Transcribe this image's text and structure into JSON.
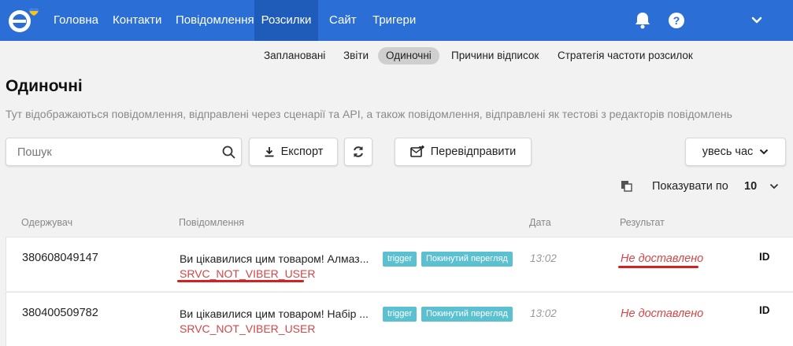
{
  "nav": {
    "items": [
      {
        "label": "Головна"
      },
      {
        "label": "Контакти"
      },
      {
        "label": "Повідомлення"
      },
      {
        "label": "Розсилки"
      },
      {
        "label": "Сайт"
      },
      {
        "label": "Тригери"
      }
    ],
    "active_index": 3
  },
  "subnav": {
    "items": [
      {
        "label": "Заплановані"
      },
      {
        "label": "Звіти"
      },
      {
        "label": "Одиночні"
      },
      {
        "label": "Причини відписок"
      },
      {
        "label": "Стратегія частоти розсилок"
      }
    ]
  },
  "page": {
    "title": "Одиночні",
    "description": "Тут відображаються повідомлення, відправлені через сценарії та API, а також повідомлення, відправлені як тестові з редакторів повідомлень"
  },
  "toolbar": {
    "search_placeholder": "Пошук",
    "export_label": "Експорт",
    "resend_label": "Перевідправити",
    "period_label": "увесь час"
  },
  "pagination": {
    "per_page_label": "Показувати по",
    "per_page_value": "10"
  },
  "table": {
    "columns": {
      "recipient": "Одержувач",
      "message": "Повідомлення",
      "date": "Дата",
      "result": "Результат"
    },
    "rows": [
      {
        "recipient": "380608049147",
        "message": "Ви цікавилися цим товаром! Алмаз...",
        "error": "SRVC_NOT_VIBER_USER",
        "tag1": "trigger",
        "tag2": "Покинутий перегляд",
        "date": "13:02",
        "result": "Не доставлено",
        "id": "ID"
      },
      {
        "recipient": "380400509782",
        "message": "Ви цікавилися цим товаром! Набір ...",
        "error": "SRVC_NOT_VIBER_USER",
        "tag1": "trigger",
        "tag2": "Покинутий перегляд",
        "date": "13:02",
        "result": "Не доставлено",
        "id": "ID"
      }
    ]
  },
  "colors": {
    "nav_bg": "#2b6fd6",
    "nav_active": "#1f5bb8",
    "error_red": "#d64545",
    "badge": "#5bc0d0",
    "highlight_underline": "#d42020"
  },
  "icons": [
    "logo-icon",
    "bell-icon",
    "help-icon",
    "chevron-down-icon",
    "search-icon",
    "download-icon",
    "refresh-icon",
    "resend-icon",
    "copy-icon"
  ]
}
